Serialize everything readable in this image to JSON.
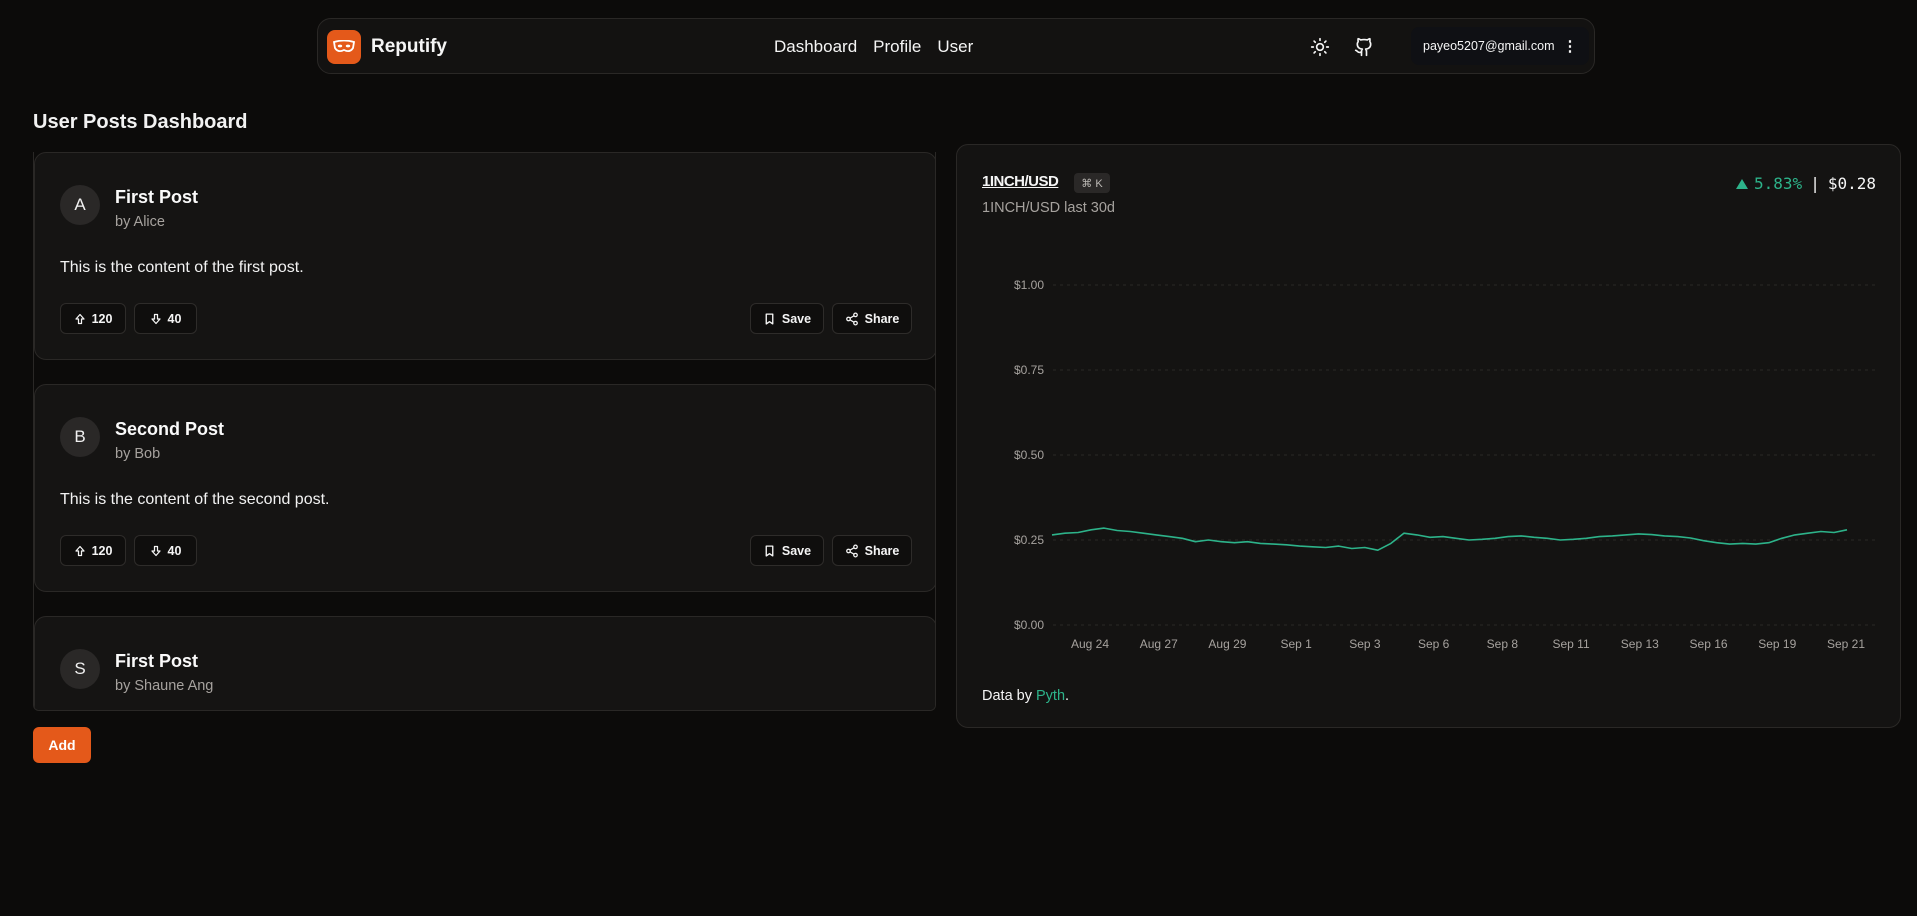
{
  "navbar": {
    "brand": "Reputify",
    "links": [
      "Dashboard",
      "Profile",
      "User"
    ],
    "user_email": "payeo5207@gmail.com",
    "icons": [
      "sun-icon",
      "github-icon",
      "more-vertical-icon"
    ]
  },
  "page": {
    "title": "User Posts Dashboard",
    "add_label": "Add"
  },
  "posts": [
    {
      "initial": "A",
      "title": "First Post",
      "author": "by Alice",
      "content": "This is the content of the first post.",
      "upvotes": "120",
      "downvotes": "40",
      "save_label": "Save",
      "share_label": "Share"
    },
    {
      "initial": "B",
      "title": "Second Post",
      "author": "by Bob",
      "content": "This is the content of the second post.",
      "upvotes": "120",
      "downvotes": "40",
      "save_label": "Save",
      "share_label": "Share"
    },
    {
      "initial": "S",
      "title": "First Post",
      "author": "by Shaune Ang",
      "content": "",
      "upvotes": "",
      "downvotes": "",
      "save_label": "",
      "share_label": ""
    }
  ],
  "chart_card": {
    "pair": "1INCH/USD",
    "shortcut": "⌘ K",
    "subtitle": "1INCH/USD last 30d",
    "change": "5.83%",
    "separator": "|",
    "price": "$0.28",
    "footer_prefix": "Data by ",
    "footer_source": "Pyth",
    "footer_suffix": ".",
    "accent": "#2db38a"
  },
  "chart_data": {
    "type": "line",
    "title": "",
    "xlabel": "",
    "ylabel": "",
    "ylim": [
      0,
      1
    ],
    "y_ticks": [
      {
        "value": 1.0,
        "label": "$1.00"
      },
      {
        "value": 0.75,
        "label": "$0.75"
      },
      {
        "value": 0.5,
        "label": "$0.50"
      },
      {
        "value": 0.25,
        "label": "$0.25"
      },
      {
        "value": 0.0,
        "label": "$0.00"
      }
    ],
    "x_ticks": [
      "Aug 24",
      "Aug 27",
      "Aug 29",
      "Sep 1",
      "Sep 3",
      "Sep 6",
      "Sep 8",
      "Sep 11",
      "Sep 13",
      "Sep 16",
      "Sep 19",
      "Sep 21"
    ],
    "grid": true,
    "series": [
      {
        "name": "",
        "color": "#2db38a",
        "values": [
          0.265,
          0.27,
          0.272,
          0.28,
          0.285,
          0.278,
          0.275,
          0.27,
          0.265,
          0.26,
          0.255,
          0.245,
          0.25,
          0.245,
          0.242,
          0.245,
          0.24,
          0.238,
          0.236,
          0.232,
          0.23,
          0.228,
          0.232,
          0.225,
          0.228,
          0.22,
          0.24,
          0.27,
          0.265,
          0.258,
          0.26,
          0.255,
          0.25,
          0.252,
          0.255,
          0.26,
          0.262,
          0.258,
          0.255,
          0.25,
          0.252,
          0.255,
          0.26,
          0.262,
          0.265,
          0.268,
          0.266,
          0.262,
          0.26,
          0.256,
          0.248,
          0.242,
          0.238,
          0.24,
          0.238,
          0.242,
          0.255,
          0.265,
          0.27,
          0.275,
          0.272,
          0.28
        ]
      }
    ]
  }
}
